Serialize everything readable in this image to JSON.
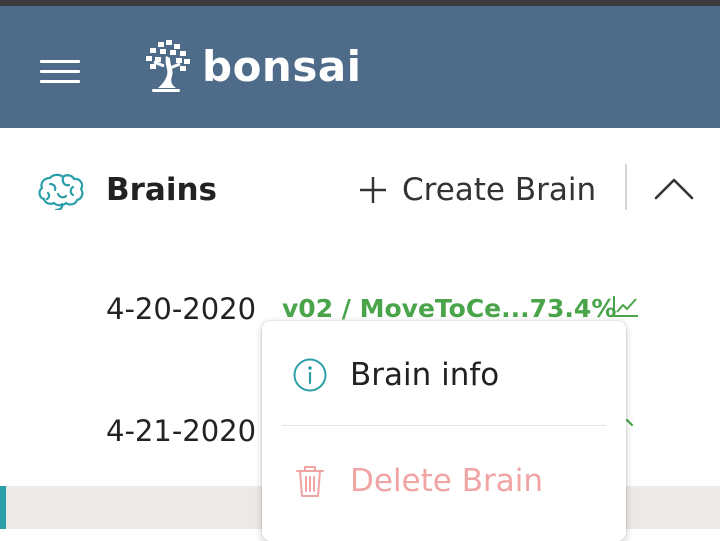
{
  "app": {
    "logo_text": "bonsai",
    "brand_color": "#4e6c89",
    "success_color": "#4aa54a",
    "danger_color": "#f0a4a4",
    "info_color": "#2a9fa8"
  },
  "section": {
    "title": "Brains",
    "icon": "brain-icon",
    "create_label": "Create Brain",
    "collapse_icon": "chevron-up-icon"
  },
  "brains": [
    {
      "date": "4-20-2020",
      "version": "v02 / MoveToCe...73.4%",
      "trend_icon": "trend-chart-icon"
    },
    {
      "date": "4-21-2020"
    }
  ],
  "context_menu": {
    "items": [
      {
        "label": "Brain info",
        "icon": "info-icon",
        "enabled": true
      },
      {
        "label": "Delete Brain",
        "icon": "trash-icon",
        "enabled": false
      }
    ]
  }
}
